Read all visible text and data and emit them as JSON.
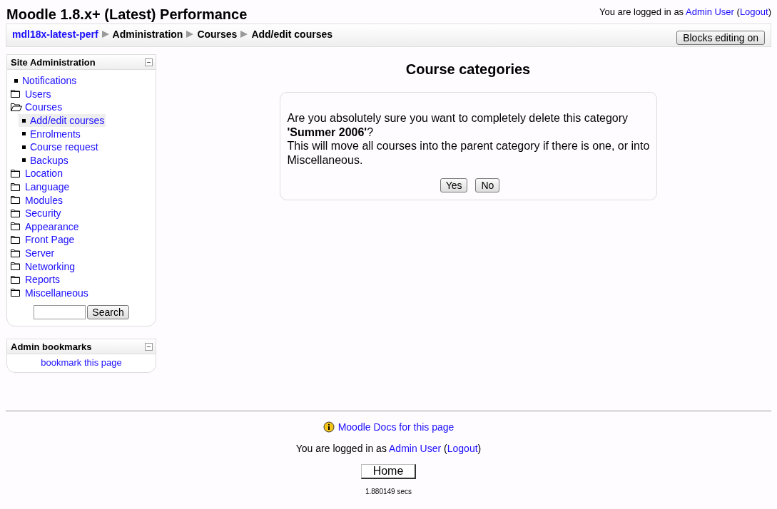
{
  "header": {
    "title": "Moodle 1.8.x+ (Latest) Performance",
    "login": {
      "prefix": "You are logged in as ",
      "user": "Admin User",
      "open": " (",
      "logout": "Logout",
      "close": ")"
    }
  },
  "navbar": {
    "crumbs": [
      {
        "label": "mdl18x-latest-perf",
        "kind": "link"
      },
      {
        "label": "Administration",
        "kind": "text"
      },
      {
        "label": "Courses",
        "kind": "text"
      },
      {
        "label": "Add/edit courses",
        "kind": "text"
      }
    ],
    "button": "Blocks editing on"
  },
  "site_admin": {
    "title": "Site Administration",
    "items": [
      {
        "label": "Notifications",
        "kind": "leaf",
        "selected": false
      },
      {
        "label": "Users",
        "kind": "folder",
        "expanded": false,
        "selected": false
      },
      {
        "label": "Courses",
        "kind": "folder",
        "expanded": true,
        "selected": false,
        "children": [
          {
            "label": "Add/edit courses",
            "kind": "leaf",
            "selected": true
          },
          {
            "label": "Enrolments",
            "kind": "leaf",
            "selected": false
          },
          {
            "label": "Course request",
            "kind": "leaf",
            "selected": false
          },
          {
            "label": "Backups",
            "kind": "leaf",
            "selected": false
          }
        ]
      },
      {
        "label": "Location",
        "kind": "folder",
        "expanded": false,
        "selected": false
      },
      {
        "label": "Language",
        "kind": "folder",
        "expanded": false,
        "selected": false
      },
      {
        "label": "Modules",
        "kind": "folder",
        "expanded": false,
        "selected": false
      },
      {
        "label": "Security",
        "kind": "folder",
        "expanded": false,
        "selected": false
      },
      {
        "label": "Appearance",
        "kind": "folder",
        "expanded": false,
        "selected": false
      },
      {
        "label": "Front Page",
        "kind": "folder",
        "expanded": false,
        "selected": false
      },
      {
        "label": "Server",
        "kind": "folder",
        "expanded": false,
        "selected": false
      },
      {
        "label": "Networking",
        "kind": "folder",
        "expanded": false,
        "selected": false
      },
      {
        "label": "Reports",
        "kind": "folder",
        "expanded": false,
        "selected": false
      },
      {
        "label": "Miscellaneous",
        "kind": "folder",
        "expanded": false,
        "selected": false
      }
    ],
    "search_button": "Search"
  },
  "bookmarks": {
    "title": "Admin bookmarks",
    "link": "bookmark this page"
  },
  "main": {
    "heading": "Course categories",
    "question": "Are you absolutely sure you want to completely delete this category **'Summer 2006'**?",
    "note": "This will move all courses into the parent category if there is one, or into Miscellaneous.",
    "buttons": [
      "Yes",
      "No"
    ]
  },
  "footer": {
    "docs_link": "Moodle Docs for this page",
    "login": {
      "prefix": "You are logged in as ",
      "user": "Admin User",
      "open": " (",
      "logout": "Logout",
      "close": ")"
    },
    "home_button": "Home",
    "timing": "1.880149 secs"
  }
}
